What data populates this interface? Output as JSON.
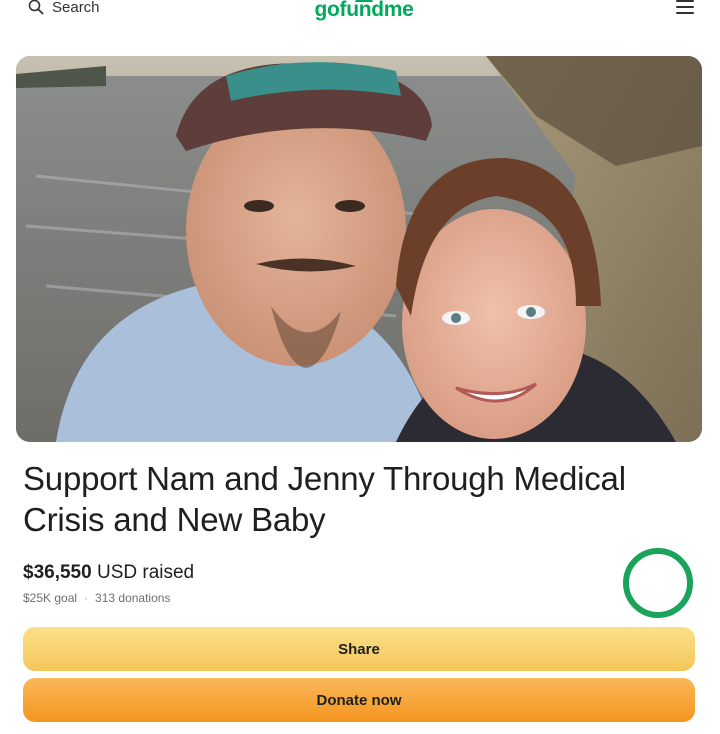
{
  "header": {
    "search_label": "Search",
    "logo_text": "gofundme",
    "search_icon": "search-icon",
    "menu_icon": "hamburger-menu-icon"
  },
  "campaign": {
    "title": "Support Nam and Jenny Through Medical Crisis and New Baby",
    "raised_amount": "$36,550",
    "raised_suffix": "USD raised",
    "goal": "$25K goal",
    "donations": "313 donations",
    "progress_fraction": 1.0
  },
  "actions": {
    "share_label": "Share",
    "donate_label": "Donate now"
  },
  "colors": {
    "brand": "#02a95c",
    "share_button": "#f6cf69",
    "donate_button": "#f7a53a",
    "progress_ring": "#1aa35a"
  }
}
